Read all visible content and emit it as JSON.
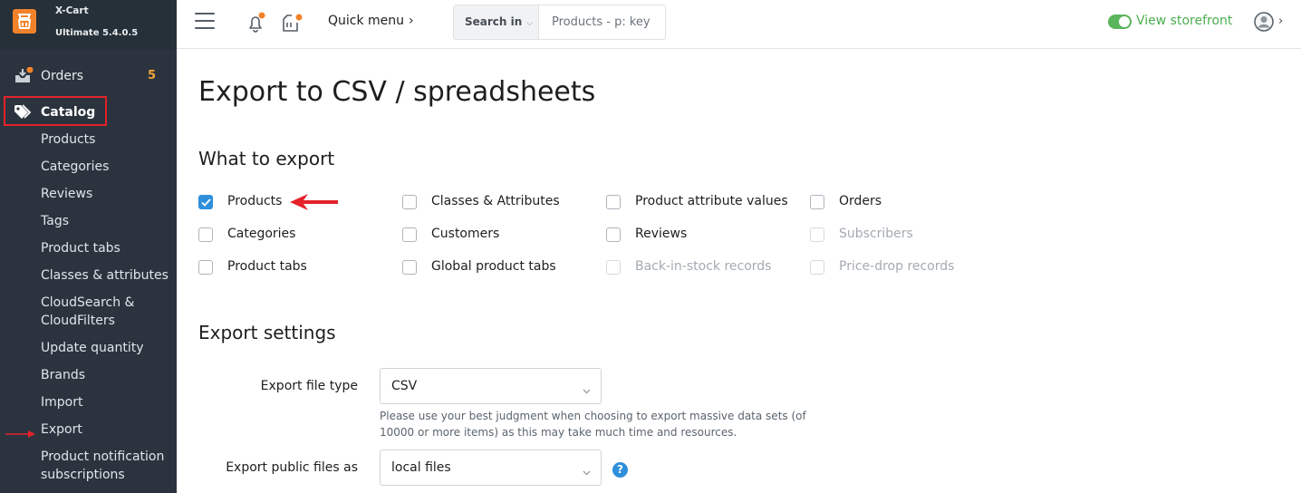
{
  "brand": {
    "name": "X-Cart",
    "version": "Ultimate 5.4.0.5"
  },
  "sidebar": {
    "orders": {
      "label": "Orders",
      "count": "5"
    },
    "catalog": {
      "label": "Catalog"
    },
    "items": [
      {
        "label": "Products"
      },
      {
        "label": "Categories"
      },
      {
        "label": "Reviews"
      },
      {
        "label": "Tags"
      },
      {
        "label": "Product tabs"
      },
      {
        "label": "Classes & attributes"
      },
      {
        "label": "CloudSearch &\nCloudFilters"
      },
      {
        "label": "Update quantity"
      },
      {
        "label": "Brands"
      },
      {
        "label": "Import"
      },
      {
        "label": "Export"
      },
      {
        "label": "Product notification\nsubscriptions"
      }
    ]
  },
  "topbar": {
    "quick_menu": "Quick menu",
    "search_in": "Search in",
    "search_placeholder": "Products - p: key",
    "view_storefront": "View storefront"
  },
  "page": {
    "title": "Export to CSV / spreadsheets",
    "what_to_export": "What to export",
    "export_options": [
      {
        "label": "Products",
        "checked": true,
        "disabled": false
      },
      {
        "label": "Classes & Attributes",
        "checked": false,
        "disabled": false
      },
      {
        "label": "Product attribute values",
        "checked": false,
        "disabled": false
      },
      {
        "label": "Orders",
        "checked": false,
        "disabled": false
      },
      {
        "label": "Categories",
        "checked": false,
        "disabled": false
      },
      {
        "label": "Customers",
        "checked": false,
        "disabled": false
      },
      {
        "label": "Reviews",
        "checked": false,
        "disabled": false
      },
      {
        "label": "Subscribers",
        "checked": false,
        "disabled": true
      },
      {
        "label": "Product tabs",
        "checked": false,
        "disabled": false
      },
      {
        "label": "Global product tabs",
        "checked": false,
        "disabled": false
      },
      {
        "label": "Back-in-stock records",
        "checked": false,
        "disabled": true
      },
      {
        "label": "Price-drop records",
        "checked": false,
        "disabled": true
      }
    ],
    "export_settings": "Export settings",
    "file_type_label": "Export file type",
    "file_type_value": "CSV",
    "file_type_help": "Please use your best judgment when choosing to export massive data sets (of 10000 or more items) as this may take much time and resources.",
    "public_files_label": "Export public files as",
    "public_files_value": "local files",
    "help_icon": "?"
  },
  "colors": {
    "sidebar_bg": "#2b343e",
    "accent_orange": "#f2822a",
    "checkbox_blue": "#2f8fdb",
    "storefront_green": "#4caf50",
    "annotation_red": "#e3222a"
  }
}
